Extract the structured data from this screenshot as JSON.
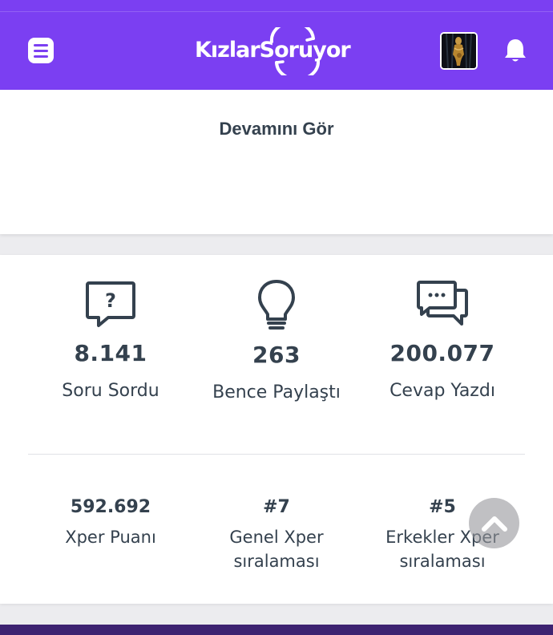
{
  "header": {
    "logo_text": "KızlarSoruyor",
    "menu_icon": "menu-icon",
    "bell_icon": "bell-icon",
    "brand_color": "#7b3ff2"
  },
  "top_card": {
    "see_more": "Devamını Gör"
  },
  "stats": [
    {
      "icon": "question-bubble-icon",
      "value": "8.141",
      "label": "Soru Sordu"
    },
    {
      "icon": "lightbulb-icon",
      "value": "263",
      "label": "Bence Paylaştı"
    },
    {
      "icon": "chat-bubbles-icon",
      "value": "200.077",
      "label": "Cevap Yazdı"
    }
  ],
  "xper": [
    {
      "value": "592.692",
      "label_line1": "Xper Puanı",
      "label_line2": ""
    },
    {
      "value": "#7",
      "label_line1": "Genel Xper",
      "label_line2": "sıralaması"
    },
    {
      "value": "#5",
      "label_line1": "Erkekler Xper",
      "label_line2": "sıralaması"
    }
  ],
  "scroll_top_icon": "chevron-up-icon"
}
